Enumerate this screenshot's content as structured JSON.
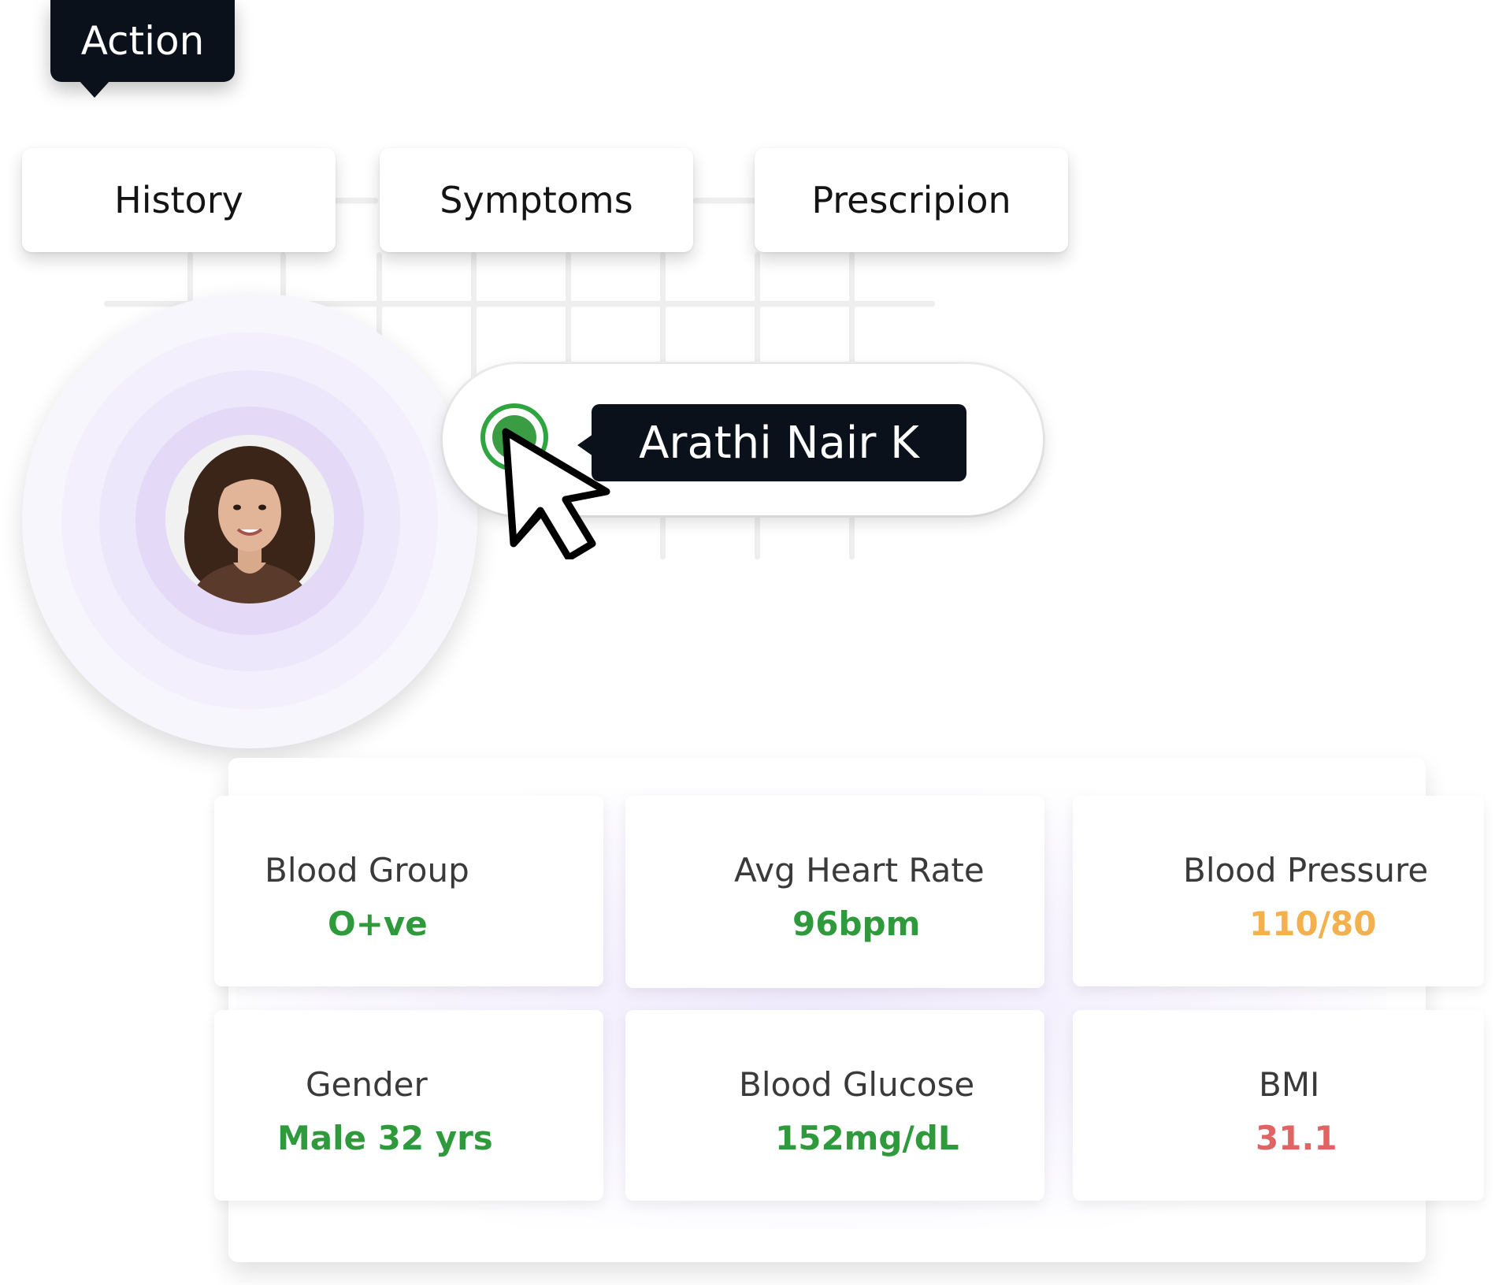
{
  "action_tag": {
    "label": "Action"
  },
  "tabs": [
    {
      "label": "History"
    },
    {
      "label": "Symptoms"
    },
    {
      "label": "Prescripion"
    }
  ],
  "patient": {
    "name": "Arathi Nair K",
    "status_color": "#3a9d43"
  },
  "vitals": [
    {
      "label": "Blood Group",
      "value": "O+ve",
      "color": "#2e9a3c"
    },
    {
      "label": "Avg Heart Rate",
      "value": "96bpm",
      "color": "#2e9a3c"
    },
    {
      "label": "Blood Pressure",
      "value": "110/80",
      "color": "#f4b04d"
    },
    {
      "label": "Gender",
      "value": "Male 32 yrs",
      "color": "#2e9a3c"
    },
    {
      "label": "Blood Glucose",
      "value": "152mg/dL",
      "color": "#2e9a3c"
    },
    {
      "label": "BMI",
      "value": "31.1",
      "color": "#e06464"
    }
  ]
}
